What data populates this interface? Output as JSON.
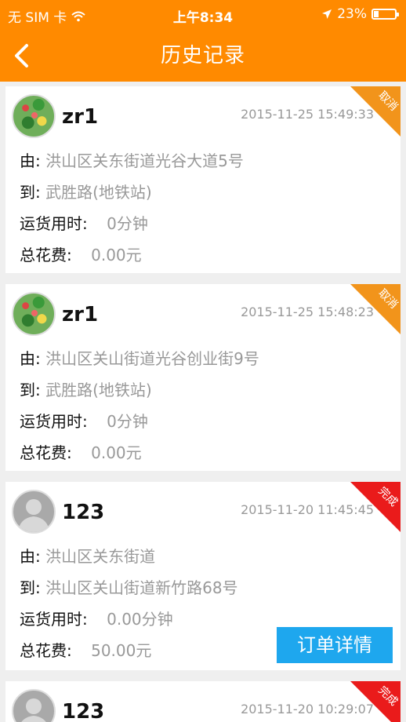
{
  "status_bar": {
    "carrier": "无 SIM 卡",
    "time": "上午8:34",
    "battery": "23%",
    "battery_level": 0.23
  },
  "header": {
    "title": "历史记录"
  },
  "labels": {
    "from": "由:",
    "to": "到:",
    "duration": "运货用时:",
    "cost": "总花费:",
    "detail_button": "订单详情"
  },
  "records": [
    {
      "user": "zr1",
      "avatar": "food-avatar",
      "time": "2015-11-25 15:49:33",
      "status": "取消",
      "status_color": "#f2941b",
      "from": "洪山区关东街道光谷大道5号",
      "to": "武胜路(地铁站)",
      "duration": "0分钟",
      "cost": "0.00元"
    },
    {
      "user": "zr1",
      "avatar": "food-avatar",
      "time": "2015-11-25 15:48:23",
      "status": "取消",
      "status_color": "#f2941b",
      "from": "洪山区关山街道光谷创业街9号",
      "to": "武胜路(地铁站)",
      "duration": "0分钟",
      "cost": "0.00元"
    },
    {
      "user": "123",
      "avatar": "default-avatar",
      "time": "2015-11-20 11:45:45",
      "status": "完成",
      "status_color": "#ea1b1b",
      "from": "洪山区关东街道",
      "to": "洪山区关山街道新竹路68号",
      "duration": "0.00分钟",
      "cost": "50.00元"
    },
    {
      "user": "123",
      "avatar": "default-avatar",
      "time": "2015-11-20 10:29:07",
      "status": "完成",
      "status_color": "#ea1b1b"
    }
  ]
}
